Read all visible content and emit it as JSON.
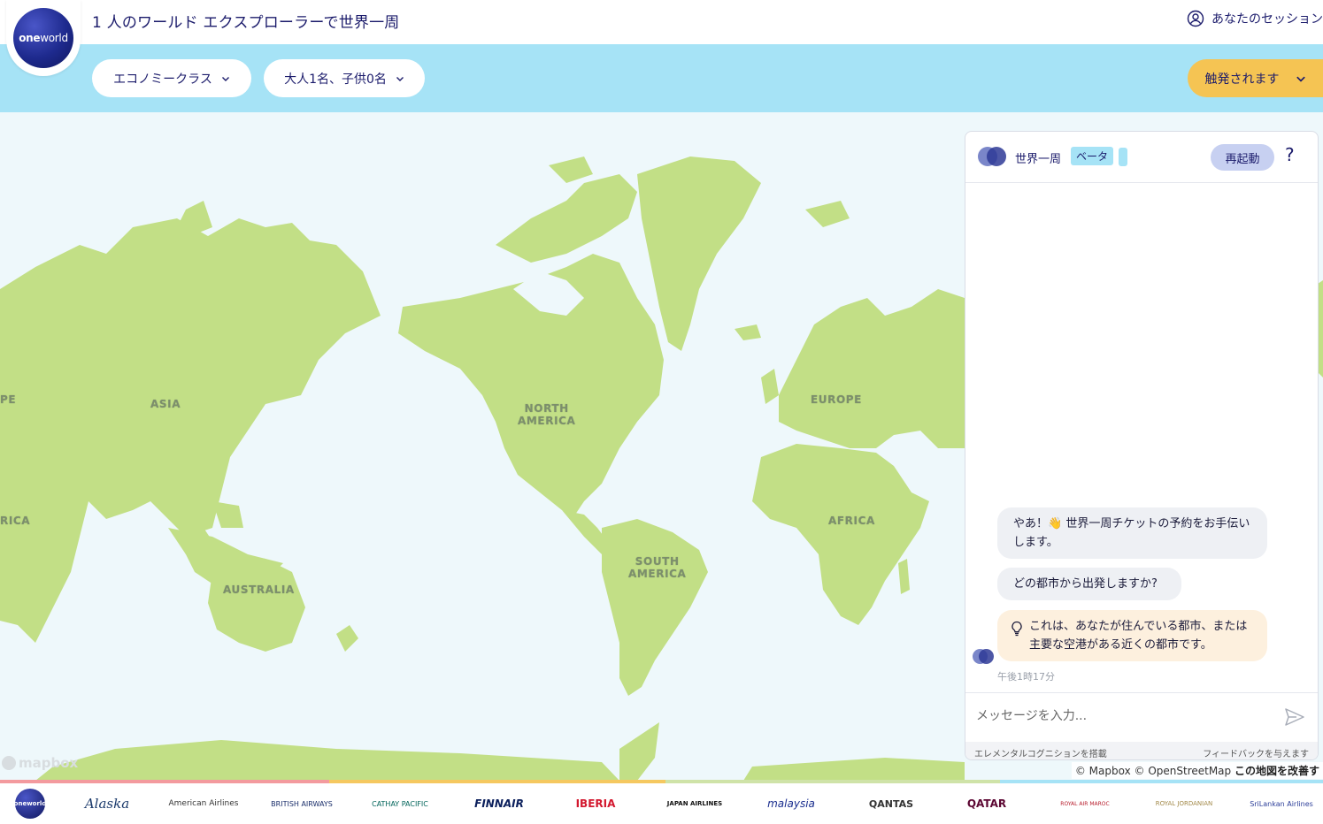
{
  "header": {
    "logo_text_bold": "one",
    "logo_text_light": "world",
    "title": "1 人のワールド エクスプローラーで世界一周",
    "session_label": "あなたのセッション",
    "session_icon": "user-circle-icon"
  },
  "filters": {
    "cabin_class": "エコノミークラス",
    "passengers": "大人1名、子供0名",
    "departure": "触発されます"
  },
  "map": {
    "labels": {
      "asia": "ASIA",
      "north_america_1": "NORTH",
      "north_america_2": "AMERICA",
      "europe": "EUROPE",
      "africa": "AFRICA",
      "south_america_1": "SOUTH",
      "south_america_2": "AMERICA",
      "australia": "AUSTRALIA",
      "edge_left_europe": "PE",
      "edge_left_africa": "RICA"
    },
    "mapbox_logo": "mapbox",
    "attribution": "© Mapbox © OpenStreetMap",
    "improve_link": "この地図を改善す",
    "colors": {
      "land": "#c2df86",
      "water": "#eef8fb"
    }
  },
  "chat": {
    "title": "世界一周",
    "beta_badge": "ベータ",
    "restart_label": "再起動",
    "help_label": "?",
    "messages": [
      {
        "text": "やあ！👋 世界一周チケットの予約をお手伝いします。"
      },
      {
        "text": "どの都市から出発しますか?"
      },
      {
        "text": "これは、あなたが住んでいる都市、または主要な空港がある近くの都市です。",
        "icon": "lightbulb-icon"
      }
    ],
    "timestamp": "午後1時17分",
    "input_placeholder": "メッセージを入力...",
    "footer_left": "エレメンタルコグニションを搭載",
    "footer_right": "フィードバックを与えます"
  },
  "strip_colors": [
    "#f39a9e",
    "#f5c860",
    "#cfe3a8",
    "#a6e3f6"
  ],
  "airlines": [
    {
      "name": "oneworld",
      "color": "#1e2a8e"
    },
    {
      "name": "Alaska",
      "color": "#1b3a6b"
    },
    {
      "name": "American Airlines",
      "color": "#333333"
    },
    {
      "name": "BRITISH AIRWAYS",
      "color": "#1b2f6b"
    },
    {
      "name": "CATHAY PACIFIC",
      "color": "#00645a"
    },
    {
      "name": "FINNAIR",
      "color": "#0b1f5c"
    },
    {
      "name": "IBERIA",
      "color": "#d3182f"
    },
    {
      "name": "JAPAN AIRLINES",
      "color": "#111111"
    },
    {
      "name": "malaysia",
      "color": "#1b2f8f"
    },
    {
      "name": "QANTAS",
      "color": "#333333"
    },
    {
      "name": "QATAR",
      "color": "#5c0632"
    },
    {
      "name": "ROYAL AIR MAROC",
      "color": "#b71c2b"
    },
    {
      "name": "ROYAL JORDANIAN",
      "color": "#a38a4a"
    },
    {
      "name": "SriLankan Airlines",
      "color": "#2c3e99"
    }
  ]
}
